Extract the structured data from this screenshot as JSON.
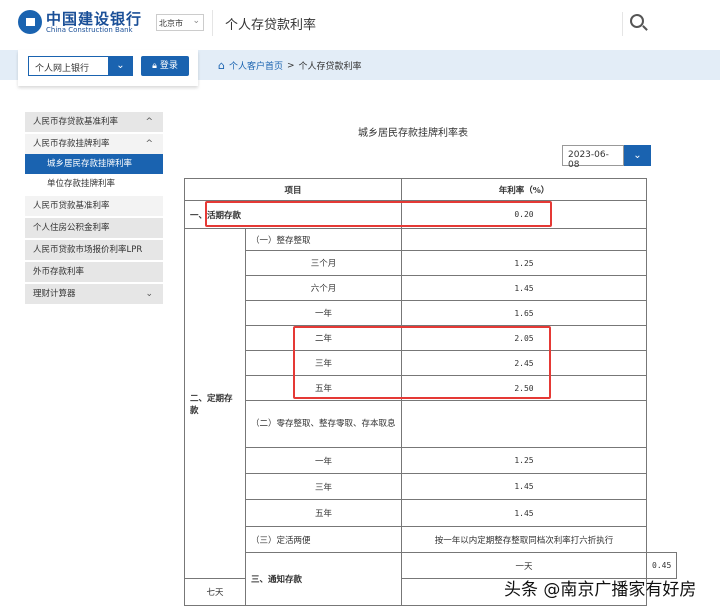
{
  "header": {
    "logo_cn": "中国建设银行",
    "logo_en": "China Construction Bank",
    "city": "北京市",
    "page_title": "个人存贷款利率"
  },
  "login": {
    "select_value": "个人网上银行",
    "login_label": "登录"
  },
  "breadcrumb": {
    "home": "个人客户首页",
    "sep": ">",
    "current": "个人存贷款利率"
  },
  "sidebar": {
    "items": [
      {
        "label": "人民币存贷款基准利率",
        "chevron": "^"
      },
      {
        "label": "人民币存款挂牌利率",
        "chevron": "^"
      },
      {
        "label": "城乡居民存款挂牌利率"
      },
      {
        "label": "单位存款挂牌利率"
      },
      {
        "label": "人民币贷款基准利率"
      },
      {
        "label": "个人住房公积金利率"
      },
      {
        "label": "人民币贷款市场报价利率LPR"
      },
      {
        "label": "外币存款利率"
      },
      {
        "label": "理财计算器",
        "chevron": "⌄"
      }
    ]
  },
  "main": {
    "title": "城乡居民存款挂牌利率表",
    "date": "2023-06-08",
    "table": {
      "headers": [
        "项目",
        "年利率（%）"
      ],
      "current": {
        "label": "一、活期存款",
        "rate": "0.20"
      },
      "fixed": {
        "label": "二、定期存款",
        "g1": {
          "label": "（一）整存整取",
          "rows": [
            [
              "三个月",
              "1.25"
            ],
            [
              "六个月",
              "1.45"
            ],
            [
              "一年",
              "1.65"
            ],
            [
              "二年",
              "2.05"
            ],
            [
              "三年",
              "2.45"
            ],
            [
              "五年",
              "2.50"
            ]
          ]
        },
        "g2": {
          "label": "（二）零存整取、整存零取、存本取息",
          "rows": [
            [
              "一年",
              "1.25"
            ],
            [
              "三年",
              "1.45"
            ],
            [
              "五年",
              "1.45"
            ]
          ]
        },
        "g3": {
          "label": "（三）定活两便",
          "rate": "按一年以内定期整存整取同档次利率打六折执行"
        }
      },
      "notice": {
        "label": "三、通知存款",
        "rows": [
          [
            "一天",
            "0.45"
          ],
          [
            "七天",
            ""
          ]
        ]
      }
    }
  },
  "watermark": "头条 @南京广播家有好房"
}
